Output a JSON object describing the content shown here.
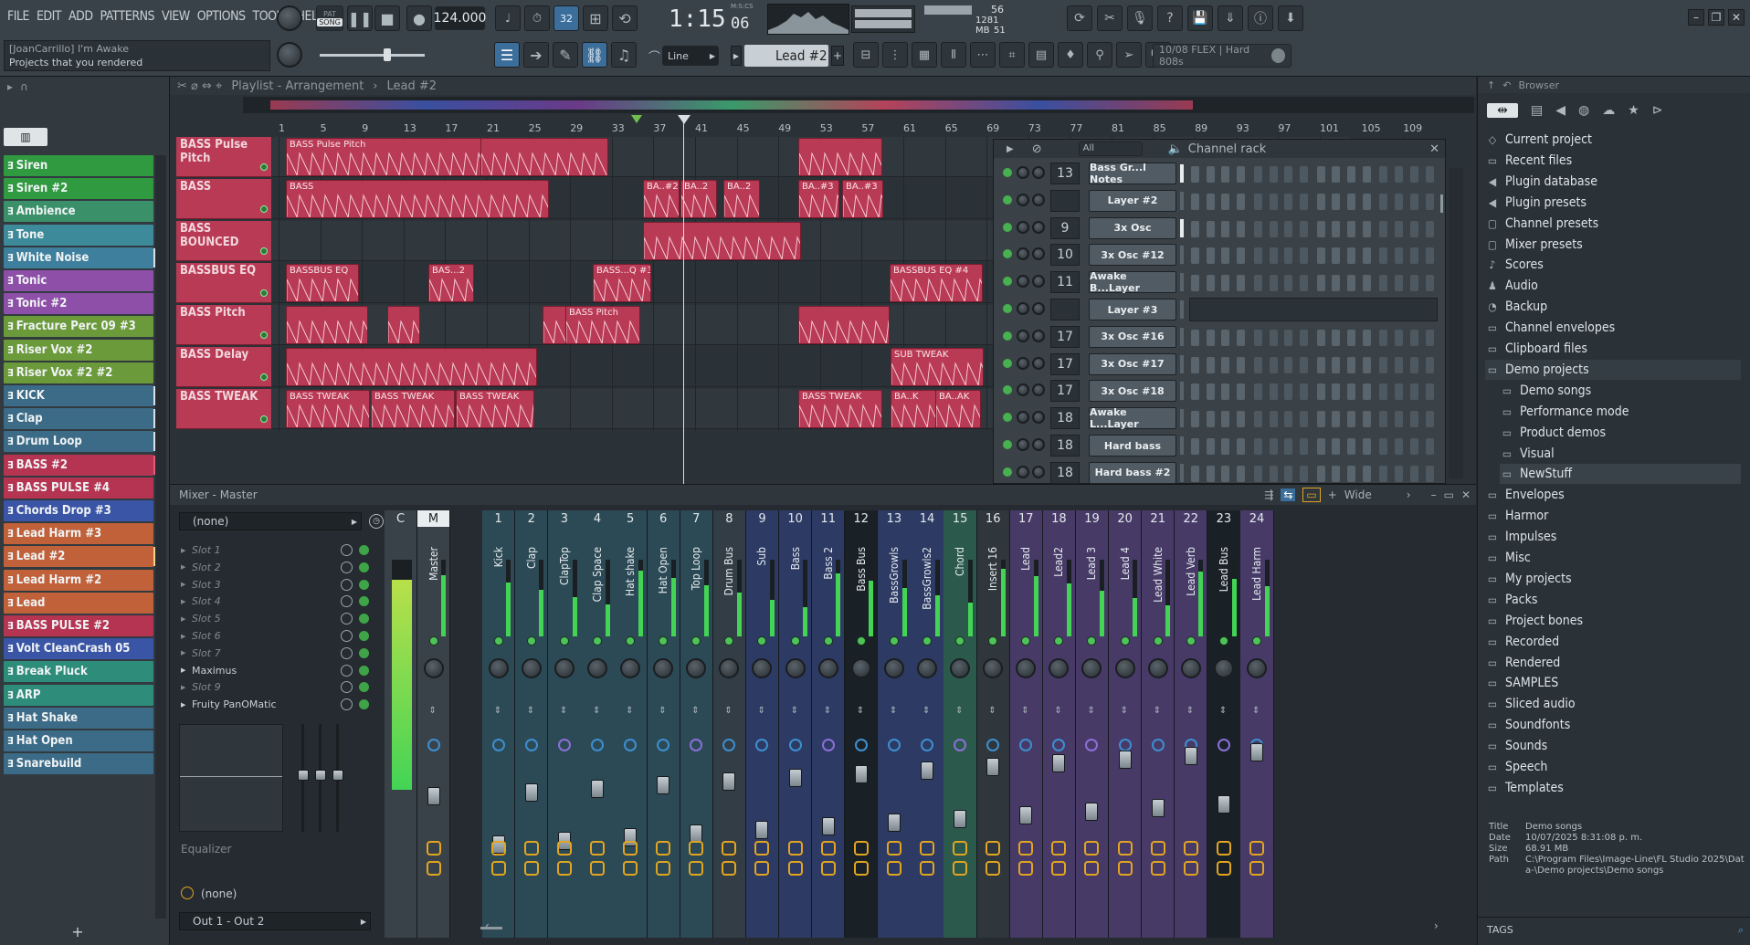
{
  "menu": [
    "FILE",
    "EDIT",
    "ADD",
    "PATTERNS",
    "VIEW",
    "OPTIONS",
    "TOOLS",
    "HELP"
  ],
  "transport": {
    "mode_label": "SONG",
    "mode_top": "PAT",
    "tempo": "124.000",
    "time": "1:15",
    "time_sub": "06",
    "time_unit": "M:S:CS",
    "step_label": "32"
  },
  "stats": {
    "cpu": "56",
    "memory": "1281 MB",
    "polyphony": "51"
  },
  "hint": {
    "line1": "[JoanCarrillo] I'm Awake",
    "line2": "Projects that you rendered"
  },
  "toolbar2": {
    "snap": "Line",
    "pattern": "Lead #2",
    "plugin_info": "10/08  FLEX | Hard 808s"
  },
  "playlist": {
    "title": "Playlist - Arrangement",
    "pattern": "Lead #2",
    "ruler": [
      "1",
      "5",
      "9",
      "13",
      "17",
      "21",
      "25",
      "29",
      "33",
      "37",
      "41",
      "45",
      "49",
      "53",
      "57",
      "61",
      "65",
      "69",
      "73",
      "77",
      "81",
      "85",
      "89",
      "93",
      "97",
      "101",
      "105",
      "109"
    ],
    "tracks": [
      "BASS Pulse Pitch",
      "BASS",
      "BASS BOUNCED",
      "BASSBUS EQ",
      "BASS  Pitch",
      "BASS Delay",
      "BASS TWEAK"
    ],
    "clip_labels": {
      "pulse": "BASS Pulse Pitch",
      "bass": "BASS",
      "ba2": "BA..#2",
      "ba2b": "BA..2",
      "ba2c": "BA..2",
      "ba3": "BA..#3",
      "ba3b": "BA..#3",
      "eq": "BASSBUS EQ",
      "eq2": "BAS...2",
      "eq3": "BASS...Q #3",
      "eq4": "BASSBUS EQ #4",
      "pitch": "BASS  Pitch",
      "sub": "SUB TWEAK",
      "tw1": "BASS TWEAK",
      "tw2": "BASS TWEAK",
      "tw3": "BASS TWEAK",
      "tw4": "BASS TWEAK",
      "tw5": "BA..K",
      "tw6": "BA..AK"
    }
  },
  "channels": [
    {
      "name": "Siren",
      "color": "#2f9a3f"
    },
    {
      "name": "Siren #2",
      "color": "#2f9a3f"
    },
    {
      "name": "Ambience",
      "color": "#3a9068"
    },
    {
      "name": "Tone",
      "color": "#3d8a9a"
    },
    {
      "name": "White Noise",
      "color": "#3d7f9c"
    },
    {
      "name": "Tonic",
      "color": "#8d4fa8"
    },
    {
      "name": "Tonic #2",
      "color": "#8d4fa8"
    },
    {
      "name": "Fracture Perc 09 #3",
      "color": "#6a9a3a"
    },
    {
      "name": "Riser Vox #2",
      "color": "#6a9a3a"
    },
    {
      "name": "Riser Vox #2 #2",
      "color": "#6a9a3a"
    },
    {
      "name": "KICK",
      "color": "#3b6b86"
    },
    {
      "name": "Clap",
      "color": "#3b6b86"
    },
    {
      "name": "Drum Loop",
      "color": "#3b6b86"
    },
    {
      "name": "BASS #2",
      "color": "#b53452"
    },
    {
      "name": "BASS PULSE #4",
      "color": "#b53452"
    },
    {
      "name": "Chords  Drop #3",
      "color": "#3a55a6"
    },
    {
      "name": "Lead Harm #3",
      "color": "#c0613a"
    },
    {
      "name": "Lead #2",
      "color": "#c0613a"
    },
    {
      "name": "Lead Harm #2",
      "color": "#c0613a"
    },
    {
      "name": "Lead",
      "color": "#c0613a"
    },
    {
      "name": "BASS PULSE #2",
      "color": "#b53452"
    },
    {
      "name": "Volt CleanCrash 05",
      "color": "#3a55a6"
    },
    {
      "name": "Break Pluck",
      "color": "#2d8c7a"
    },
    {
      "name": "ARP",
      "color": "#2d8c7a"
    },
    {
      "name": "Hat Shake",
      "color": "#3b6b86"
    },
    {
      "name": "Hat Open",
      "color": "#3b6b86"
    },
    {
      "name": "Snarebuild",
      "color": "#3b6b86"
    }
  ],
  "rack": {
    "title": "Channel rack",
    "filter": "All",
    "rows": [
      {
        "num": "13",
        "name": "Bass Gr...l Notes"
      },
      {
        "num": "",
        "name": "Layer #2"
      },
      {
        "num": "9",
        "name": "3x Osc"
      },
      {
        "num": "10",
        "name": "3x Osc #12"
      },
      {
        "num": "11",
        "name": "Awake B...Layer"
      },
      {
        "num": "",
        "name": "Layer #3"
      },
      {
        "num": "17",
        "name": "3x Osc #16"
      },
      {
        "num": "17",
        "name": "3x Osc #17"
      },
      {
        "num": "17",
        "name": "3x Osc #18"
      },
      {
        "num": "18",
        "name": "Awake L...Layer"
      },
      {
        "num": "18",
        "name": "Hard bass"
      },
      {
        "num": "18",
        "name": "Hard bass #2"
      }
    ]
  },
  "mixer": {
    "title": "Mixer - Master",
    "preset": "(none)",
    "view": "Wide",
    "slots": [
      "Slot 1",
      "Slot 2",
      "Slot 3",
      "Slot 4",
      "Slot 5",
      "Slot 6",
      "Slot 7",
      "Maximus",
      "Slot 9",
      "Fruity PanOMatic"
    ],
    "eq_label": "Equalizer",
    "out_preset": "(none)",
    "output": "Out 1 - Out 2",
    "strips": [
      {
        "num": "C",
        "name": "",
        "color": "#3a4249"
      },
      {
        "num": "M",
        "name": "Master",
        "color": "#3a4249"
      },
      {
        "num": "1",
        "name": "Kick",
        "color": "#2c4a55"
      },
      {
        "num": "2",
        "name": "Clap",
        "color": "#2c4a55"
      },
      {
        "num": "3",
        "name": "ClapTop",
        "color": "#2c4a55"
      },
      {
        "num": "4",
        "name": "Clap Space",
        "color": "#2c4a55"
      },
      {
        "num": "5",
        "name": "Hat shake",
        "color": "#2c4a55"
      },
      {
        "num": "6",
        "name": "Hat Open",
        "color": "#2c4a55"
      },
      {
        "num": "7",
        "name": "Top Loop",
        "color": "#2c4a55"
      },
      {
        "num": "8",
        "name": "Drum Bus",
        "color": "#333d45"
      },
      {
        "num": "9",
        "name": "Sub",
        "color": "#2d3a63"
      },
      {
        "num": "10",
        "name": "Bass",
        "color": "#2d3a63"
      },
      {
        "num": "11",
        "name": "Bass 2",
        "color": "#2d3a63"
      },
      {
        "num": "12",
        "name": "Bass Bus",
        "color": "#1a2126"
      },
      {
        "num": "13",
        "name": "BassGrowls",
        "color": "#2d3a63"
      },
      {
        "num": "14",
        "name": "BassGrowls2",
        "color": "#2d3a63"
      },
      {
        "num": "15",
        "name": "Chord",
        "color": "#2b5a4c"
      },
      {
        "num": "16",
        "name": "Insert 16",
        "color": "#2f363c"
      },
      {
        "num": "17",
        "name": "Lead",
        "color": "#473a67"
      },
      {
        "num": "18",
        "name": "Lead2",
        "color": "#473a67"
      },
      {
        "num": "19",
        "name": "Lead 3",
        "color": "#473a67"
      },
      {
        "num": "20",
        "name": "Lead 4",
        "color": "#473a67"
      },
      {
        "num": "21",
        "name": "Lead White",
        "color": "#473a67"
      },
      {
        "num": "22",
        "name": "Lead Verb",
        "color": "#473a67"
      },
      {
        "num": "23",
        "name": "Lead Bus",
        "color": "#1a2126"
      },
      {
        "num": "24",
        "name": "Lead Harm",
        "color": "#473a67"
      }
    ]
  },
  "browser": {
    "title": "Browser",
    "items": [
      "Current project",
      "Recent files",
      "Plugin database",
      "Plugin presets",
      "Channel presets",
      "Mixer presets",
      "Scores",
      "Audio",
      "Backup",
      "Channel envelopes",
      "Clipboard files",
      "Demo projects",
      "Demo songs",
      "Performance mode",
      "Product demos",
      "Visual",
      "NewStuff",
      "Envelopes",
      "Harmor",
      "Impulses",
      "Misc",
      "My projects",
      "Packs",
      "Project bones",
      "Recorded",
      "Rendered",
      "SAMPLES",
      "Sliced audio",
      "Soundfonts",
      "Sounds",
      "Speech",
      "Templates"
    ],
    "info": {
      "title_label": "Title",
      "title": "Demo songs",
      "date_label": "Date",
      "date": "10/07/2025 8:31:08 p. m.",
      "size_label": "Size",
      "size": "68.91 MB",
      "path_label": "Path",
      "path": "C:\\Program Files\\Image-Line\\FL Studio 2025\\Data-\\Demo projects\\Demo songs"
    },
    "tags": "TAGS"
  },
  "colors": {
    "accent": "#4f9bdd",
    "clip": "#b83a55",
    "meter": "#43d455"
  }
}
